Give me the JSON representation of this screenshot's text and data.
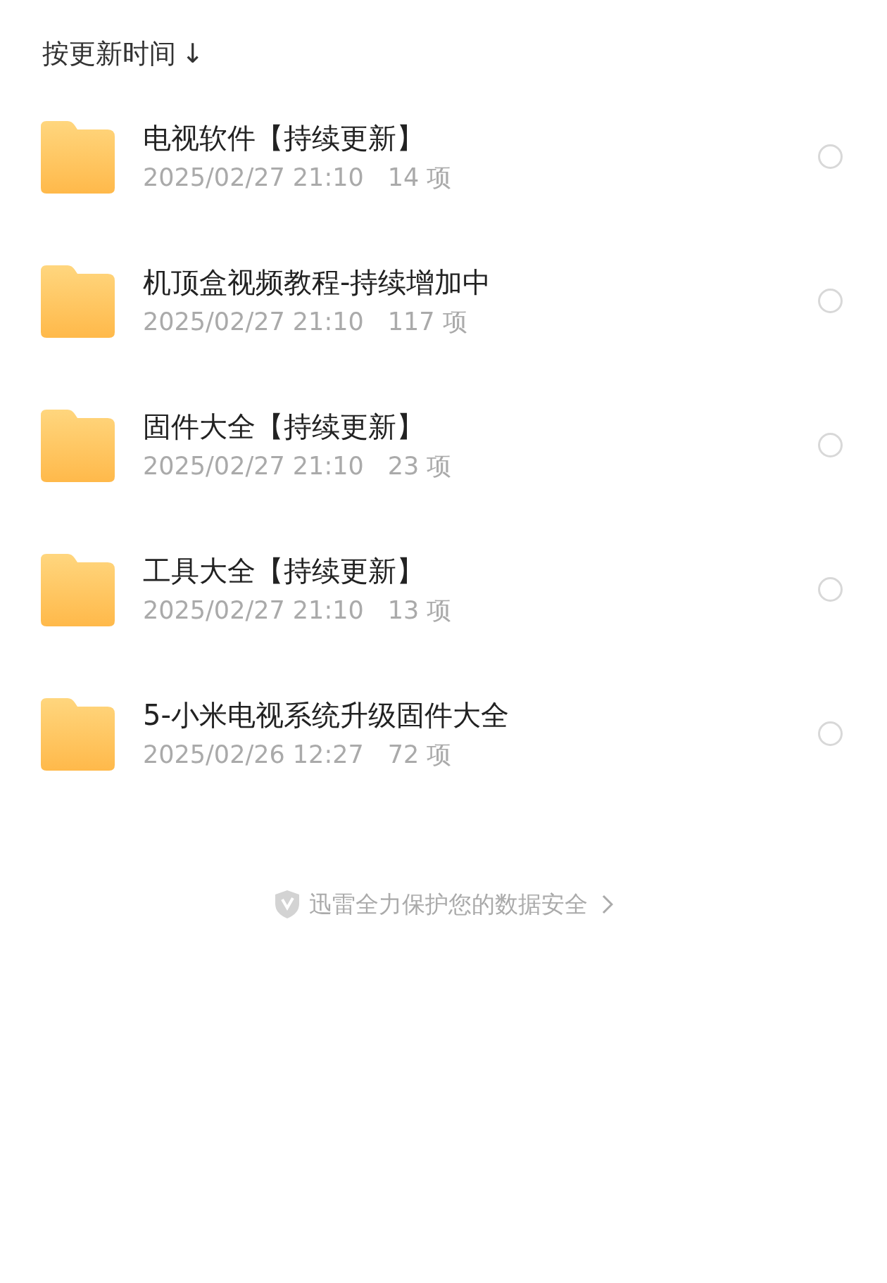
{
  "sort": {
    "label": "按更新时间",
    "arrow": "↓"
  },
  "folders": [
    {
      "name": "电视软件【持续更新】",
      "date": "2025/02/27 21:10",
      "count": "14 项",
      "selected": false
    },
    {
      "name": "机顶盒视频教程-持续增加中",
      "date": "2025/02/27 21:10",
      "count": "117 项",
      "selected": false
    },
    {
      "name": "固件大全【持续更新】",
      "date": "2025/02/27 21:10",
      "count": "23 项",
      "selected": false
    },
    {
      "name": "工具大全【持续更新】",
      "date": "2025/02/27 21:10",
      "count": "13 项",
      "selected": false
    },
    {
      "name": "5-小米电视系统升级固件大全",
      "date": "2025/02/26 12:27",
      "count": "72 项",
      "selected": false
    }
  ],
  "footer": {
    "text": "迅雷全力保护您的数据安全"
  }
}
